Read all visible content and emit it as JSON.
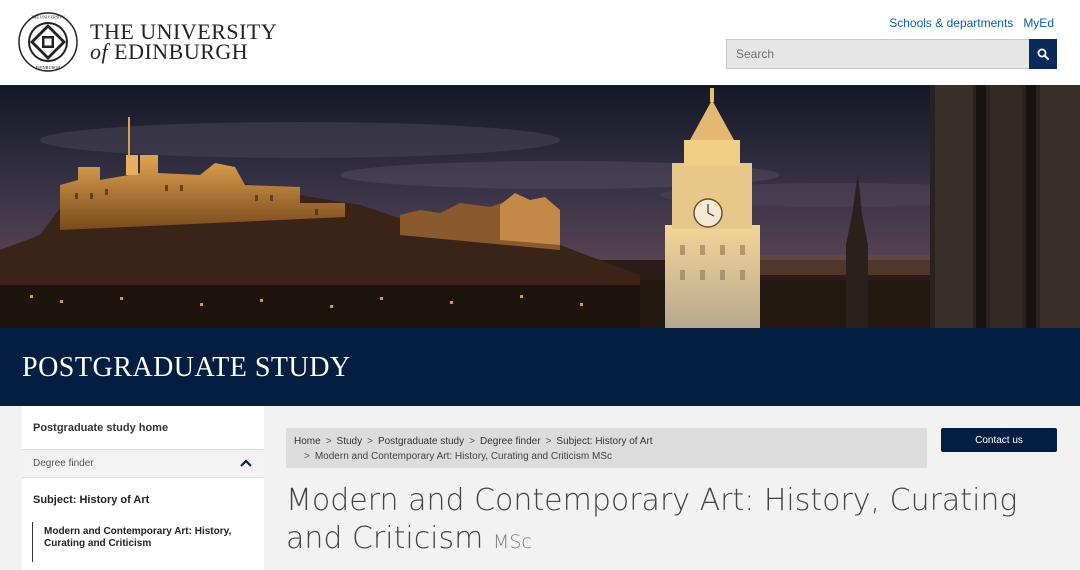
{
  "header": {
    "logo_line1": "THE UNIVERSITY",
    "logo_of": "of",
    "logo_line2": "EDINBURGH",
    "top_links": [
      "Schools & departments",
      "MyEd"
    ],
    "search_placeholder": "Search",
    "brand_color": "#041e42",
    "link_color": "#0b5ca8"
  },
  "banner": {
    "title": "POSTGRADUATE STUDY"
  },
  "sidebar": {
    "home": "Postgraduate study home",
    "finder": "Degree finder",
    "subject": "Subject: History of Art",
    "current": "Modern and Contemporary Art: History, Curating and Criticism"
  },
  "breadcrumb": {
    "items": [
      "Home",
      "Study",
      "Postgraduate study",
      "Degree finder",
      "Subject: History of Art"
    ],
    "current": "Modern and Contemporary Art: History, Curating and Criticism MSc",
    "separator": ">"
  },
  "actions": {
    "contact": "Contact us"
  },
  "page": {
    "title": "Modern and Contemporary Art: History, Curating and Criticism",
    "qualification": "MSc"
  },
  "icons": {
    "crest": "university-crest-icon",
    "search": "search-icon",
    "chevron": "chevron-up-icon"
  }
}
